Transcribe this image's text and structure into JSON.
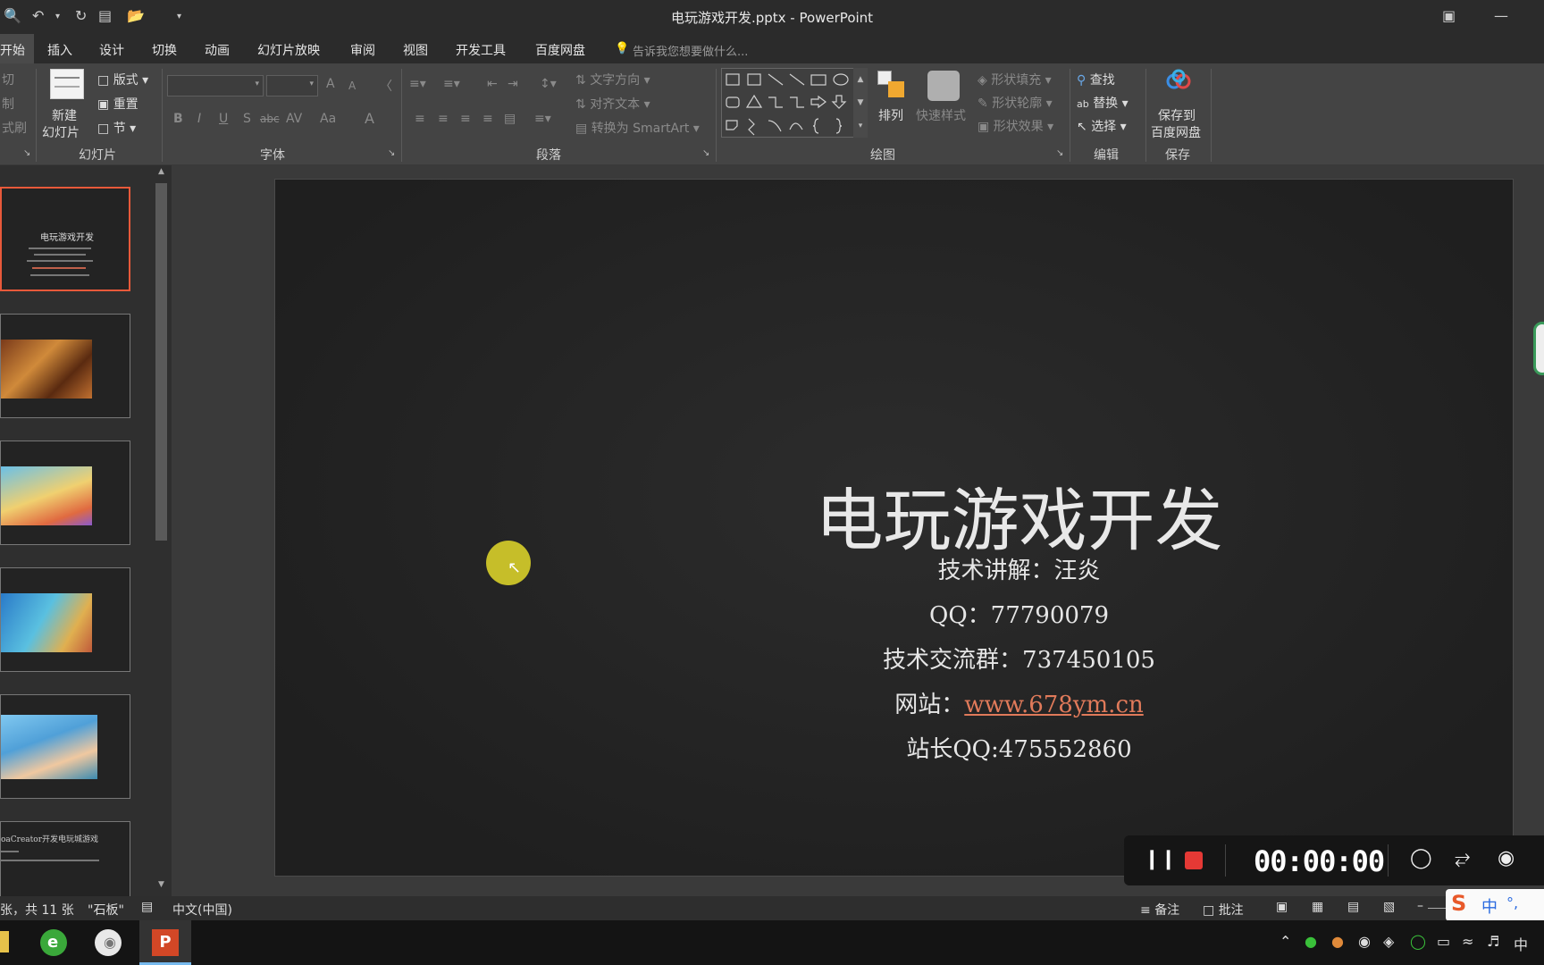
{
  "window": {
    "title": "电玩游戏开发.pptx - PowerPoint"
  },
  "menu": {
    "tabs": [
      "开始",
      "插入",
      "设计",
      "切换",
      "动画",
      "幻灯片放映",
      "审阅",
      "视图",
      "开发工具",
      "百度网盘"
    ],
    "tell_me": "告诉我您想要做什么..."
  },
  "ribbon": {
    "clipboard": {
      "cut": "切",
      "copy": "制",
      "painter": "式刷"
    },
    "slides": {
      "new_slide_1": "新建",
      "new_slide_2": "幻灯片",
      "layout": "版式",
      "reset": "重置",
      "section": "节",
      "group": "幻灯片"
    },
    "font": {
      "group": "字体",
      "bold": "B",
      "italic": "I",
      "underline": "U",
      "shadow": "S",
      "strike": "abc",
      "spacing": "AV",
      "case": "Aa",
      "color": "A",
      "grow": "A",
      "shrink": "A"
    },
    "paragraph": {
      "group": "段落",
      "text_direction": "文字方向",
      "align_text": "对齐文本",
      "smartart": "转换为 SmartArt"
    },
    "drawing": {
      "group": "绘图",
      "arrange": "排列",
      "quick_styles": "快速样式",
      "fill": "形状填充",
      "outline": "形状轮廓",
      "effects": "形状效果"
    },
    "editing": {
      "group": "编辑",
      "find": "查找",
      "replace": "替换",
      "select": "选择"
    },
    "save": {
      "group": "保存",
      "label_1": "保存到",
      "label_2": "百度网盘"
    }
  },
  "thumbnails": {
    "slide1": {
      "title": "电玩游戏开发"
    },
    "slide6": {
      "title": "oaCreator开发电玩城游戏"
    }
  },
  "slide": {
    "title": "电玩游戏开发",
    "line1": "技术讲解：汪炎",
    "line2": "QQ：77790079",
    "line3": "技术交流群：737450105",
    "line4_prefix": "网站：",
    "line4_link": "www.678ym.cn",
    "line5": "站长QQ:475552860"
  },
  "status": {
    "slide_info": "张，共 11 张",
    "theme": "\"石板\"",
    "language": "中文(中国)",
    "notes": "备注",
    "comments": "批注"
  },
  "recorder": {
    "time": "00:00:00"
  },
  "ime": {
    "mode": "中"
  },
  "tray": {
    "ime": "中"
  },
  "colors": {
    "accent": "#e8593a",
    "link": "#e07a5a",
    "cursor_highlight": "#d8cf2a",
    "record": "#e53935"
  }
}
